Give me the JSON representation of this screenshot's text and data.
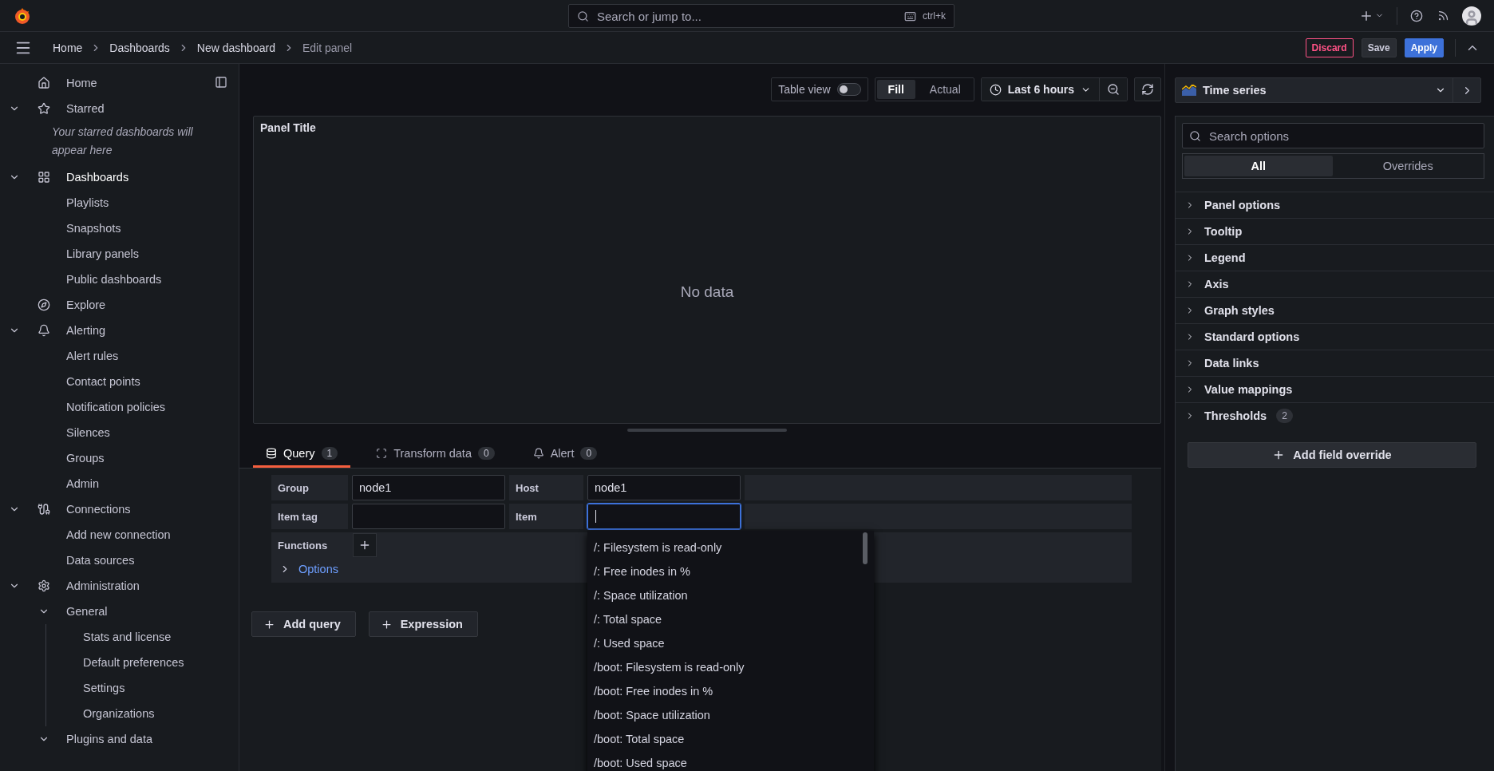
{
  "topbar": {
    "search": {
      "placeholder": "Search or jump to..."
    },
    "shortcut": "ctrl+k"
  },
  "breadcrumbs": [
    "Home",
    "Dashboards",
    "New dashboard",
    "Edit panel"
  ],
  "actions": [
    {
      "label": "Discard",
      "kind": "danger"
    },
    {
      "label": "Save",
      "kind": "secondary"
    },
    {
      "label": "Apply",
      "kind": "primary"
    }
  ],
  "sidebar": {
    "items": [
      {
        "label": "Home",
        "selected": false
      },
      {
        "label": "Starred",
        "selected": false,
        "expanded": true,
        "note": "Your starred dashboards will appear here"
      },
      {
        "label": "Dashboards",
        "selected": true,
        "expanded": true,
        "children": [
          {
            "label": "Playlists",
            "selected": false
          },
          {
            "label": "Snapshots",
            "selected": false
          },
          {
            "label": "Library panels",
            "selected": false
          },
          {
            "label": "Public dashboards",
            "selected": false
          }
        ]
      },
      {
        "label": "Explore",
        "selected": false
      },
      {
        "label": "Alerting",
        "selected": false,
        "expanded": true,
        "children": [
          {
            "label": "Alert rules",
            "selected": false
          },
          {
            "label": "Contact points",
            "selected": false
          },
          {
            "label": "Notification policies",
            "selected": false
          },
          {
            "label": "Silences",
            "selected": false
          },
          {
            "label": "Groups",
            "selected": false
          },
          {
            "label": "Admin",
            "selected": false
          }
        ]
      },
      {
        "label": "Connections",
        "selected": false,
        "expanded": true,
        "children": [
          {
            "label": "Add new connection",
            "selected": false
          },
          {
            "label": "Data sources",
            "selected": false
          }
        ]
      },
      {
        "label": "Administration",
        "selected": false,
        "expanded": true,
        "children": [
          {
            "label": "General",
            "selected": false,
            "expanded": true,
            "children": [
              {
                "label": "Stats and license",
                "selected": false
              },
              {
                "label": "Default preferences",
                "selected": false
              },
              {
                "label": "Settings",
                "selected": false
              },
              {
                "label": "Organizations",
                "selected": false
              }
            ]
          },
          {
            "label": "Plugins and data",
            "selected": false,
            "expanded": true
          }
        ]
      }
    ]
  },
  "panel_toolbar": {
    "table_view": {
      "label": "Table view",
      "on": false
    },
    "fill_modes": [
      {
        "label": "Fill",
        "selected": true
      },
      {
        "label": "Actual",
        "selected": false
      }
    ],
    "time_range": "Last 6 hours"
  },
  "panel": {
    "title": "Panel Title",
    "message": "No data"
  },
  "query_tabs": [
    {
      "label": "Query",
      "count": "1",
      "selected": true
    },
    {
      "label": "Transform data",
      "count": "0",
      "selected": false
    },
    {
      "label": "Alert",
      "count": "0",
      "selected": false
    }
  ],
  "query": {
    "rows": [
      [
        {
          "label": "Group",
          "value": "node1",
          "focused": false
        },
        {
          "label": "Host",
          "value": "node1",
          "focused": false
        }
      ],
      [
        {
          "label": "Item tag",
          "focused": false
        },
        {
          "label": "Item",
          "focused": true
        }
      ]
    ],
    "functions_label": "Functions",
    "options": {
      "label": "Options",
      "expanded": false
    }
  },
  "query_buttons": [
    "Add query",
    "Expression"
  ],
  "item_suggestions": [
    "/: Filesystem is read-only",
    "/: Free inodes in %",
    "/: Space utilization",
    "/: Total space",
    "/: Used space",
    "/boot: Filesystem is read-only",
    "/boot: Free inodes in %",
    "/boot: Space utilization",
    "/boot: Total space",
    "/boot: Used space"
  ],
  "options_pane": {
    "visualization": "Time series",
    "search": {
      "placeholder": "Search options"
    },
    "tabs": [
      {
        "label": "All",
        "selected": true
      },
      {
        "label": "Overrides",
        "selected": false
      }
    ],
    "sections": [
      {
        "label": "Panel options",
        "expanded": false
      },
      {
        "label": "Tooltip",
        "expanded": false
      },
      {
        "label": "Legend",
        "expanded": false
      },
      {
        "label": "Axis",
        "expanded": false
      },
      {
        "label": "Graph styles",
        "expanded": false
      },
      {
        "label": "Standard options",
        "expanded": false
      },
      {
        "label": "Data links",
        "expanded": false
      },
      {
        "label": "Value mappings",
        "expanded": false
      },
      {
        "label": "Thresholds",
        "expanded": false,
        "count": "2"
      }
    ],
    "add_override": "Add field override"
  }
}
